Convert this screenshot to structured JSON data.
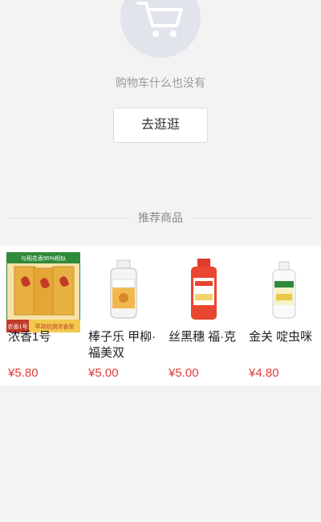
{
  "empty_cart": {
    "icon": "shopping-cart-icon",
    "message": "购物车什么也没有",
    "go_shopping_label": "去逛逛"
  },
  "recommend": {
    "title": "推荐商品",
    "products": [
      {
        "name": "浓香1号",
        "price": "¥5.80",
        "image_text_top": "与稻花香95%相似",
        "image_badge": "农香1号",
        "image_text_bottom": "早熟抗倒浓香型"
      },
      {
        "name": "棒子乐 甲柳·福美双",
        "price": "¥5.00"
      },
      {
        "name": "丝黑穗 福·克",
        "price": "¥5.00"
      },
      {
        "name": "金关 啶虫咪",
        "price": "¥4.80"
      }
    ]
  },
  "colors": {
    "price": "#e03b3b",
    "accent_green": "#2f8a3a",
    "background": "#f3f3f3"
  }
}
